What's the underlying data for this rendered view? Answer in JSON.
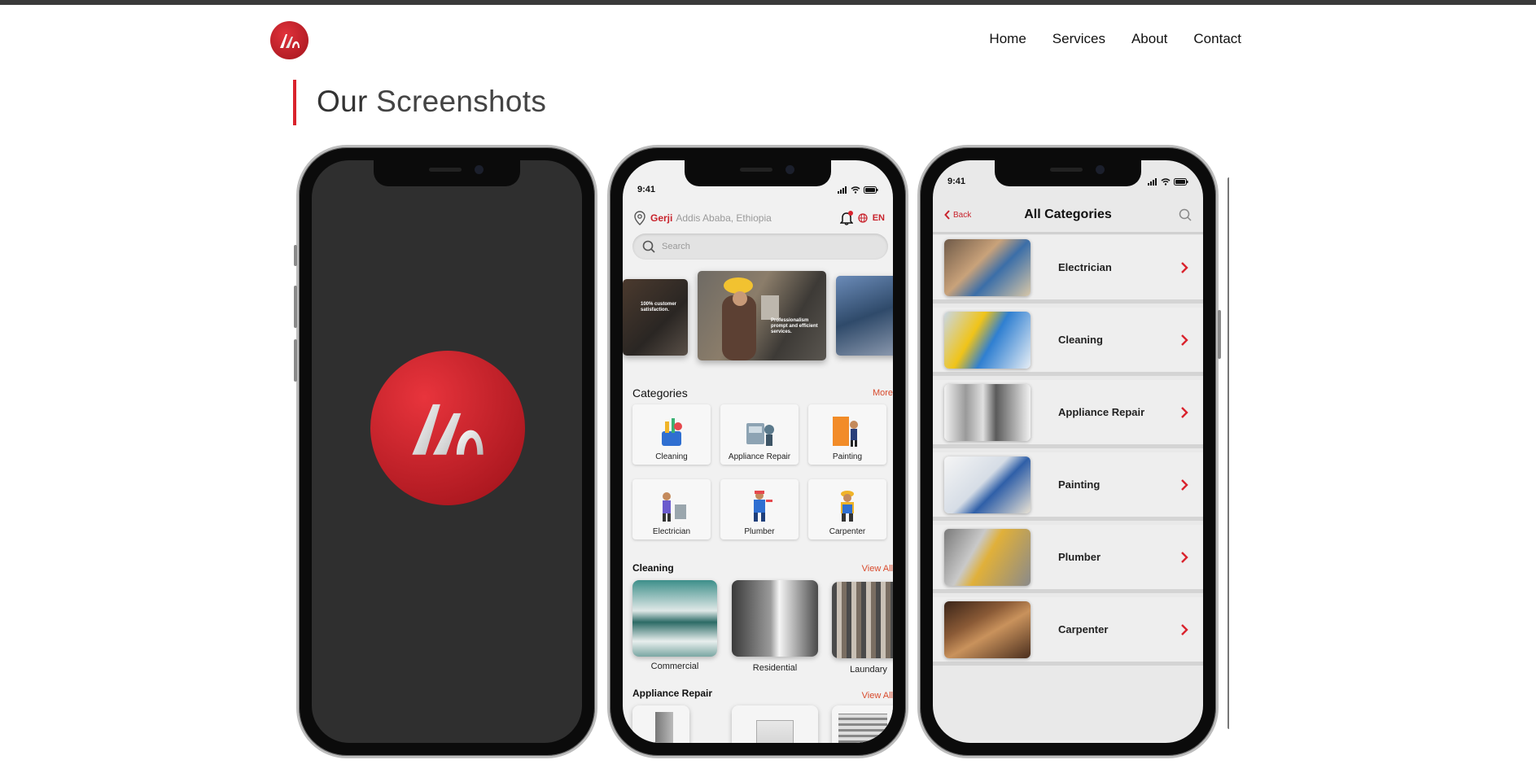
{
  "nav": {
    "items": [
      "Home",
      "Services",
      "About",
      "Contact"
    ]
  },
  "heading": {
    "strong": "Our",
    "rest": " Screenshots"
  },
  "home": {
    "time": "9:41",
    "location_name": "Gerji",
    "location_city": "Addis Ababa, Ethiopia",
    "lang": "EN",
    "search_placeholder": "Search",
    "banner_left_caption": "100% customer satisfaction.",
    "banner_center_caption": "Professionalism prompt and efficient services.",
    "categories_title": "Categories",
    "categories_more": "More",
    "categories": [
      "Cleaning",
      "Appliance Repair",
      "Painting",
      "Electrician",
      "Plumber",
      "Carpenter"
    ],
    "cleaning_title": "Cleaning",
    "cleaning_view_all": "View All",
    "cleaning_items": [
      "Commercial",
      "Residential",
      "Laundary"
    ],
    "appliance_title": "Appliance Repair",
    "appliance_view_all": "View All"
  },
  "all_categories": {
    "time": "9:41",
    "back": "Back",
    "title": "All Categories",
    "items": [
      "Electrician",
      "Cleaning",
      "Appliance Repair",
      "Painting",
      "Plumber",
      "Carpenter"
    ]
  },
  "colors": {
    "brand_red": "#d9232d",
    "splash_bg": "#2f2f2f"
  }
}
